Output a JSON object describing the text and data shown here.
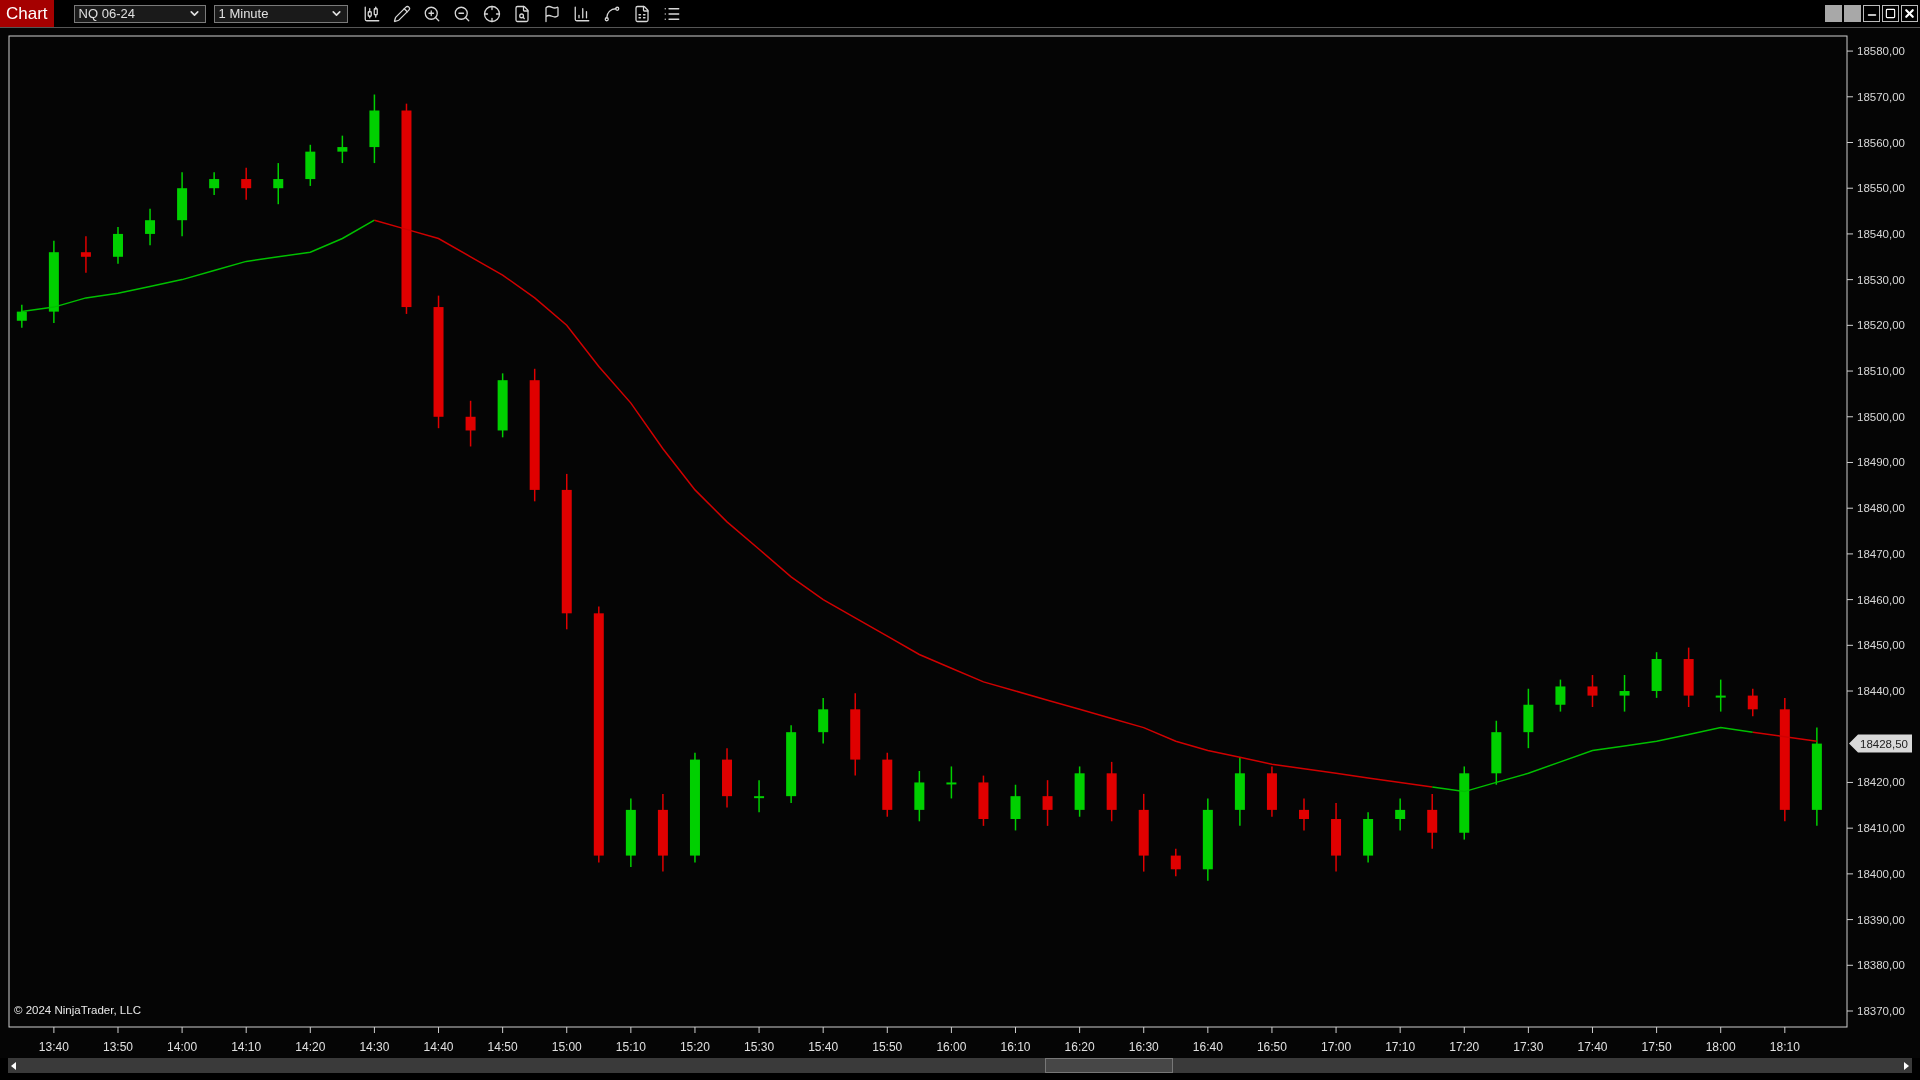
{
  "window": {
    "title": "Chart"
  },
  "toolbar": {
    "instrument": "NQ 06-24",
    "interval": "1 Minute"
  },
  "chart": {
    "copyright": "© 2024 NinjaTrader, LLC",
    "last_price": "18428,50",
    "chart_data": {
      "type": "candlestick",
      "xlim": [
        813,
        1099.7
      ],
      "x": [
        815,
        820,
        825,
        830,
        835,
        840,
        845,
        850,
        855,
        860,
        865,
        870,
        875,
        880,
        885,
        890,
        895,
        900,
        905,
        910,
        915,
        920,
        925,
        930,
        935,
        940,
        945,
        950,
        955,
        960,
        965,
        970,
        975,
        980,
        985,
        990,
        995,
        1000,
        1005,
        1010,
        1015,
        1020,
        1025,
        1030,
        1035,
        1040,
        1045,
        1050,
        1055,
        1060,
        1065,
        1070,
        1075,
        1080,
        1085,
        1090,
        1095
      ],
      "ohlc": [
        [
          18521,
          18524.5,
          18519.5,
          18523
        ],
        [
          18523,
          18538.5,
          18520.5,
          18536
        ],
        [
          18536,
          18539.5,
          18531.5,
          18535
        ],
        [
          18535,
          18541.5,
          18533.5,
          18540
        ],
        [
          18540,
          18545.5,
          18537.5,
          18543
        ],
        [
          18543,
          18553.5,
          18539.5,
          18550
        ],
        [
          18550,
          18553.5,
          18548.5,
          18552
        ],
        [
          18552,
          18554.5,
          18547.5,
          18550
        ],
        [
          18550,
          18555.5,
          18546.5,
          18552
        ],
        [
          18552,
          18559.5,
          18550.5,
          18558
        ],
        [
          18558,
          18561.5,
          18555.5,
          18559
        ],
        [
          18559,
          18570.5,
          18555.5,
          18567
        ],
        [
          18567,
          18568.5,
          18522.5,
          18524
        ],
        [
          18524,
          18526.5,
          18497.5,
          18500
        ],
        [
          18500,
          18503.5,
          18493.5,
          18497
        ],
        [
          18497,
          18509.5,
          18495.5,
          18508
        ],
        [
          18508,
          18510.5,
          18481.5,
          18484
        ],
        [
          18484,
          18487.5,
          18453.5,
          18457
        ],
        [
          18457,
          18458.5,
          18402.5,
          18404
        ],
        [
          18404,
          18416.5,
          18401.5,
          18414
        ],
        [
          18414,
          18417.5,
          18400.5,
          18404
        ],
        [
          18404,
          18426.5,
          18402.5,
          18425
        ],
        [
          18425,
          18427.5,
          18414.5,
          18417
        ],
        [
          18417,
          18420.5,
          18413.5,
          18417
        ],
        [
          18417,
          18432.5,
          18415.5,
          18431
        ],
        [
          18431,
          18438.5,
          18428.5,
          18436
        ],
        [
          18436,
          18439.5,
          18421.5,
          18425
        ],
        [
          18425,
          18426.5,
          18412.5,
          18414
        ],
        [
          18414,
          18422.5,
          18411.5,
          18420
        ],
        [
          18420,
          18423.5,
          18416.5,
          18420
        ],
        [
          18420,
          18421.5,
          18410.5,
          18412
        ],
        [
          18412,
          18419.5,
          18409.5,
          18417
        ],
        [
          18417,
          18420.5,
          18410.5,
          18414
        ],
        [
          18414,
          18423.5,
          18412.5,
          18422
        ],
        [
          18422,
          18424.5,
          18411.5,
          18414
        ],
        [
          18414,
          18417.5,
          18400.5,
          18404
        ],
        [
          18404,
          18405.5,
          18399.5,
          18401
        ],
        [
          18401,
          18416.5,
          18398.5,
          18414
        ],
        [
          18414,
          18425.5,
          18410.5,
          18422
        ],
        [
          18422,
          18423.5,
          18412.5,
          18414
        ],
        [
          18414,
          18416.5,
          18409.5,
          18412
        ],
        [
          18412,
          18415.5,
          18400.5,
          18404
        ],
        [
          18404,
          18413.5,
          18402.5,
          18412
        ],
        [
          18412,
          18416.5,
          18409.5,
          18414
        ],
        [
          18414,
          18417.5,
          18405.5,
          18409
        ],
        [
          18409,
          18423.5,
          18407.5,
          18422
        ],
        [
          18422,
          18433.5,
          18419.5,
          18431
        ],
        [
          18431,
          18440.5,
          18427.5,
          18437
        ],
        [
          18437,
          18442.5,
          18435.5,
          18441
        ],
        [
          18441,
          18443.5,
          18436.5,
          18439
        ],
        [
          18439,
          18443.5,
          18435.5,
          18440
        ],
        [
          18440,
          18448.5,
          18438.5,
          18447
        ],
        [
          18447,
          18449.5,
          18436.5,
          18439
        ],
        [
          18439,
          18442.5,
          18435.5,
          18439
        ],
        [
          18439,
          18440.5,
          18434.5,
          18436
        ],
        [
          18436,
          18438.5,
          18411.5,
          18414
        ],
        [
          18414,
          18432,
          18410.5,
          18428.5
        ]
      ],
      "ylim": [
        18366.5,
        18583.3
      ],
      "yticks": [
        {
          "value": 18580,
          "label": "18580,00"
        },
        {
          "value": 18570,
          "label": "18570,00"
        },
        {
          "value": 18560,
          "label": "18560,00"
        },
        {
          "value": 18550,
          "label": "18550,00"
        },
        {
          "value": 18540,
          "label": "18540,00"
        },
        {
          "value": 18530,
          "label": "18530,00"
        },
        {
          "value": 18520,
          "label": "18520,00"
        },
        {
          "value": 18510,
          "label": "18510,00"
        },
        {
          "value": 18500,
          "label": "18500,00"
        },
        {
          "value": 18490,
          "label": "18490,00"
        },
        {
          "value": 18480,
          "label": "18480,00"
        },
        {
          "value": 18470,
          "label": "18470,00"
        },
        {
          "value": 18460,
          "label": "18460,00"
        },
        {
          "value": 18450,
          "label": "18450,00"
        },
        {
          "value": 18440,
          "label": "18440,00"
        },
        {
          "value": 18420,
          "label": "18420,00"
        },
        {
          "value": 18410,
          "label": "18410,00"
        },
        {
          "value": 18400,
          "label": "18400,00"
        },
        {
          "value": 18390,
          "label": "18390,00"
        },
        {
          "value": 18380,
          "label": "18380,00"
        },
        {
          "value": 18370,
          "label": "18370,00"
        }
      ],
      "xticks": [
        {
          "value": 820,
          "label": "13:40"
        },
        {
          "value": 830,
          "label": "13:50"
        },
        {
          "value": 840,
          "label": "14:00"
        },
        {
          "value": 850,
          "label": "14:10"
        },
        {
          "value": 860,
          "label": "14:20"
        },
        {
          "value": 870,
          "label": "14:30"
        },
        {
          "value": 880,
          "label": "14:40"
        },
        {
          "value": 890,
          "label": "14:50"
        },
        {
          "value": 900,
          "label": "15:00"
        },
        {
          "value": 910,
          "label": "15:10"
        },
        {
          "value": 920,
          "label": "15:20"
        },
        {
          "value": 930,
          "label": "15:30"
        },
        {
          "value": 940,
          "label": "15:40"
        },
        {
          "value": 950,
          "label": "15:50"
        },
        {
          "value": 960,
          "label": "16:00"
        },
        {
          "value": 970,
          "label": "16:10"
        },
        {
          "value": 980,
          "label": "16:20"
        },
        {
          "value": 990,
          "label": "16:30"
        },
        {
          "value": 1000,
          "label": "16:40"
        },
        {
          "value": 1010,
          "label": "16:50"
        },
        {
          "value": 1020,
          "label": "17:00"
        },
        {
          "value": 1030,
          "label": "17:10"
        },
        {
          "value": 1040,
          "label": "17:20"
        },
        {
          "value": 1050,
          "label": "17:30"
        },
        {
          "value": 1060,
          "label": "17:40"
        },
        {
          "value": 1070,
          "label": "17:50"
        },
        {
          "value": 1080,
          "label": "18:00"
        },
        {
          "value": 1090,
          "label": "18:10"
        }
      ]
    },
    "moving_average": {
      "chart_data": {
        "type": "line",
        "xlim": [
          813,
          1099.7
        ],
        "ylim": [
          18366.5,
          18583.3
        ],
        "x": [
          815,
          820,
          825,
          830,
          835,
          840,
          845,
          850,
          855,
          860,
          865,
          870,
          875,
          880,
          885,
          890,
          895,
          900,
          905,
          910,
          915,
          920,
          925,
          930,
          935,
          940,
          945,
          950,
          955,
          960,
          965,
          970,
          975,
          980,
          985,
          990,
          995,
          1000,
          1005,
          1010,
          1015,
          1020,
          1025,
          1030,
          1035,
          1040,
          1045,
          1050,
          1055,
          1060,
          1065,
          1070,
          1075,
          1080,
          1085,
          1090,
          1095
        ],
        "series": [
          {
            "color": "#00c000",
            "values": [
              18523,
              18524,
              18526,
              18527,
              18528.5,
              18530,
              18532,
              18534,
              18535,
              18536,
              18539,
              18543,
              null,
              null,
              null,
              null,
              null,
              null,
              null,
              null,
              null,
              null,
              null,
              null,
              null,
              null,
              null,
              null,
              null,
              null,
              null,
              null,
              null,
              null,
              null,
              null,
              null,
              null,
              null,
              null,
              null,
              null,
              null,
              null,
              18419,
              18418,
              18420,
              18422,
              18424.5,
              18427,
              18428,
              18429,
              18430.5,
              18432,
              18431,
              null,
              null
            ]
          },
          {
            "color": "#d00000",
            "values": [
              null,
              null,
              null,
              null,
              null,
              null,
              null,
              null,
              null,
              null,
              null,
              18543,
              18541,
              18539,
              18535,
              18531,
              18526,
              18520,
              18511,
              18503,
              18493,
              18484,
              18477,
              18471,
              18465,
              18460,
              18456,
              18452,
              18448,
              18445,
              18442,
              18440,
              18438,
              18436,
              18434,
              18432,
              18429,
              18427,
              18425.5,
              18424,
              18423,
              18422,
              18421,
              18420,
              18419,
              null,
              null,
              null,
              null,
              null,
              null,
              null,
              null,
              null,
              18431,
              18430,
              18429
            ]
          }
        ]
      }
    }
  }
}
